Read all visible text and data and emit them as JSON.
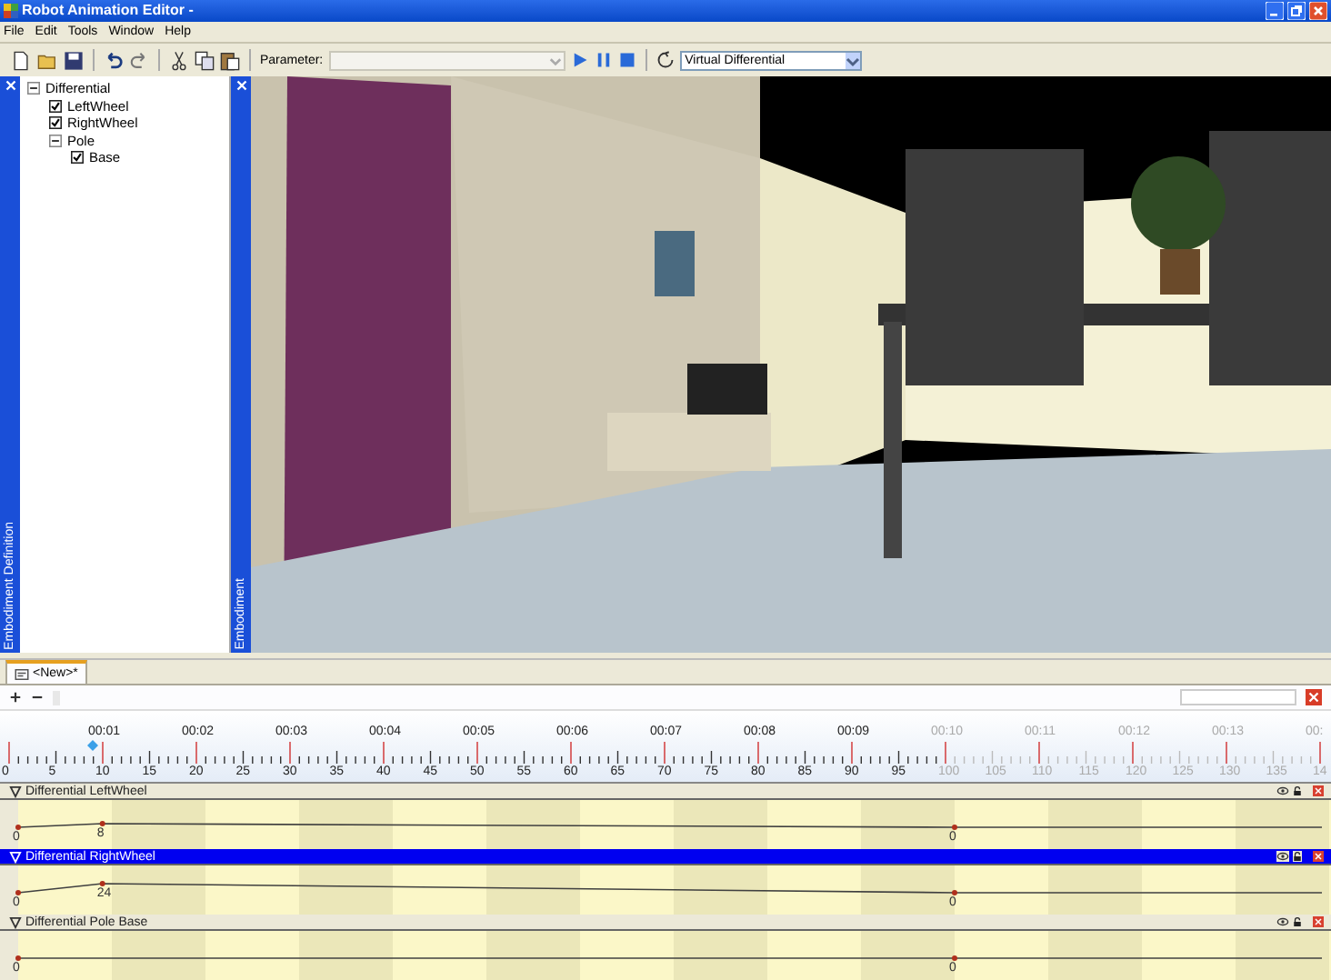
{
  "window": {
    "title": "Robot Animation Editor -"
  },
  "menu": [
    "File",
    "Edit",
    "Tools",
    "Window",
    "Help"
  ],
  "toolbar": {
    "parameter_label": "Parameter:",
    "parameter_disabled": true,
    "embodiment_select": "Virtual Differential"
  },
  "definition_panel": {
    "title": "Embodiment Definition",
    "tree": [
      {
        "label": "Differential",
        "expanded": true,
        "children": [
          {
            "label": "LeftWheel",
            "checked": true
          },
          {
            "label": "RightWheel",
            "checked": true
          },
          {
            "label": "Pole",
            "expanded": true,
            "children": [
              {
                "label": "Base",
                "checked": true
              }
            ]
          }
        ]
      }
    ]
  },
  "view_panel": {
    "title": "Embodiment"
  },
  "timeline": {
    "tabs": [
      {
        "label": "<New>*",
        "selected": true
      }
    ],
    "seconds": [
      {
        "label": "00:01",
        "active": true
      },
      {
        "label": "00:02",
        "active": true
      },
      {
        "label": "00:03",
        "active": true
      },
      {
        "label": "00:04",
        "active": true
      },
      {
        "label": "00:05",
        "active": true
      },
      {
        "label": "00:06",
        "active": true
      },
      {
        "label": "00:07",
        "active": true
      },
      {
        "label": "00:08",
        "active": true
      },
      {
        "label": "00:09",
        "active": true
      },
      {
        "label": "00:10",
        "active": false
      },
      {
        "label": "00:11",
        "active": false
      },
      {
        "label": "00:12",
        "active": false
      },
      {
        "label": "00:13",
        "active": false
      },
      {
        "label": "00:",
        "active": false
      }
    ],
    "frames": [
      {
        "label": "0",
        "active": true
      },
      {
        "label": "5",
        "active": true
      },
      {
        "label": "10",
        "active": true
      },
      {
        "label": "15",
        "active": true
      },
      {
        "label": "20",
        "active": true
      },
      {
        "label": "25",
        "active": true
      },
      {
        "label": "30",
        "active": true
      },
      {
        "label": "35",
        "active": true
      },
      {
        "label": "40",
        "active": true
      },
      {
        "label": "45",
        "active": true
      },
      {
        "label": "50",
        "active": true
      },
      {
        "label": "55",
        "active": true
      },
      {
        "label": "60",
        "active": true
      },
      {
        "label": "65",
        "active": true
      },
      {
        "label": "70",
        "active": true
      },
      {
        "label": "75",
        "active": true
      },
      {
        "label": "80",
        "active": true
      },
      {
        "label": "85",
        "active": true
      },
      {
        "label": "90",
        "active": true
      },
      {
        "label": "95",
        "active": true
      },
      {
        "label": "100",
        "active": false
      },
      {
        "label": "105",
        "active": false
      },
      {
        "label": "110",
        "active": false
      },
      {
        "label": "115",
        "active": false
      },
      {
        "label": "120",
        "active": false
      },
      {
        "label": "125",
        "active": false
      },
      {
        "label": "130",
        "active": false
      },
      {
        "label": "135",
        "active": false
      },
      {
        "label": "14",
        "active": false
      }
    ],
    "tracks": [
      {
        "name": "Differential LeftWheel",
        "selected": false,
        "keys": [
          "0",
          "8",
          "0"
        ]
      },
      {
        "name": "Differential RightWheel",
        "selected": true,
        "keys": [
          "0",
          "24",
          "0"
        ]
      },
      {
        "name": "Differential Pole Base",
        "selected": false,
        "keys": [
          "0",
          "0"
        ]
      }
    ]
  }
}
